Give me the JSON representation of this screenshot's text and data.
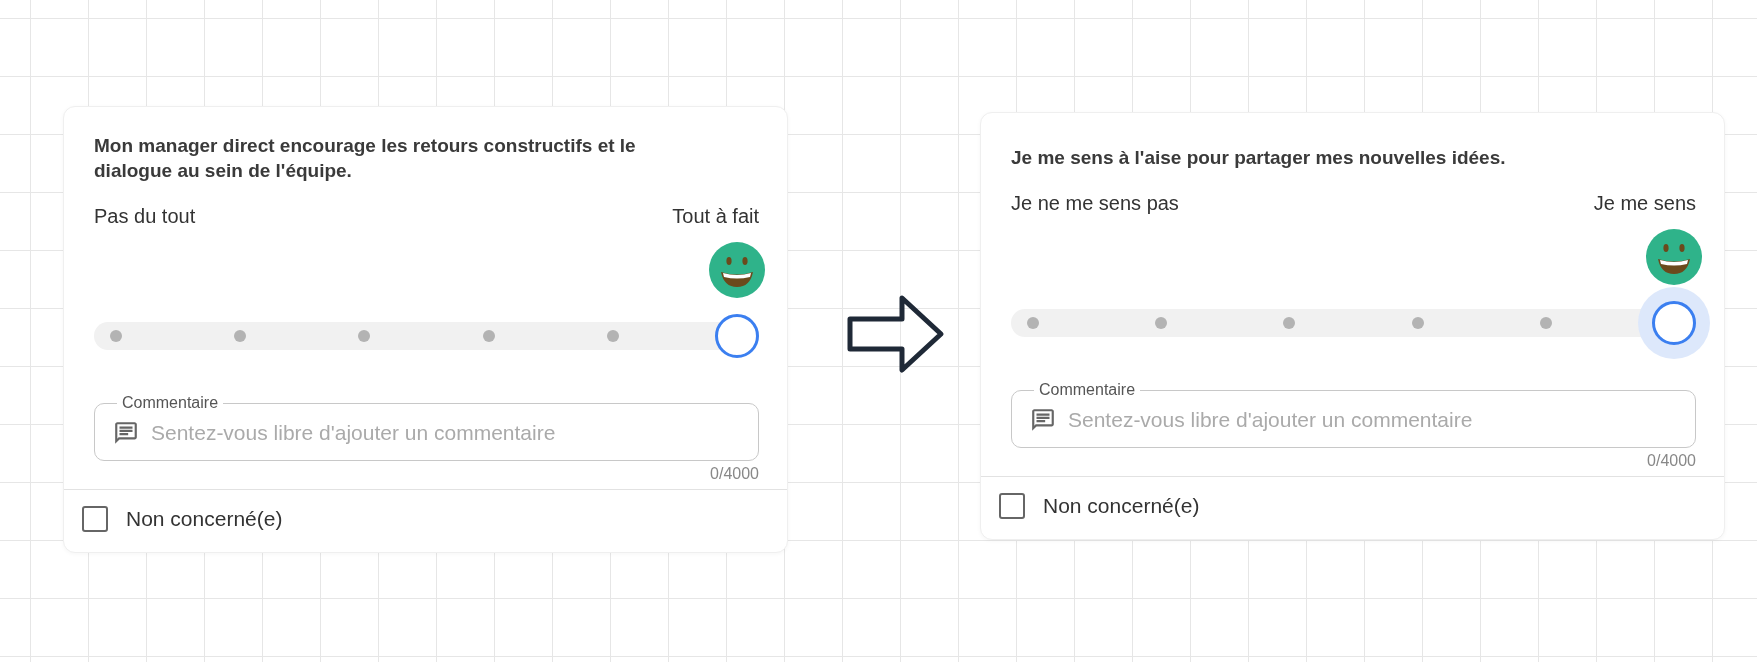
{
  "cards": [
    {
      "question": "Mon manager direct encourage les retours constructifs et le dialogue au sein de l'équipe.",
      "scale": {
        "min_label": "Pas du tout",
        "max_label": "Tout à fait"
      },
      "slider": {
        "level": 1,
        "focused": false
      },
      "comment": {
        "label": "Commentaire",
        "placeholder": "Sentez-vous libre d'ajouter un commentaire",
        "counter": "0/4000"
      },
      "not_applicable": {
        "label": "Non concerné(e)",
        "checked": false
      }
    },
    {
      "question": "Je me sens à l'aise pour partager mes nouvelles idées.",
      "scale": {
        "min_label": "Je ne me sens pas",
        "max_label": "Je me sens"
      },
      "slider": {
        "level": 1,
        "focused": true
      },
      "comment": {
        "label": "Commentaire",
        "placeholder": "Sentez-vous libre d'ajouter un commentaire",
        "counter": "0/4000"
      },
      "not_applicable": {
        "label": "Non concerné(e)",
        "checked": false
      }
    }
  ]
}
